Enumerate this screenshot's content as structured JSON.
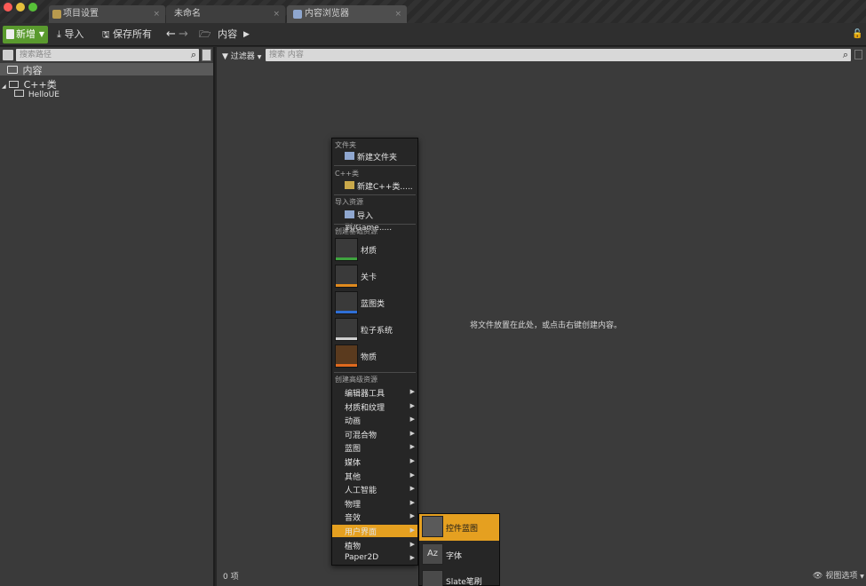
{
  "tabs": [
    {
      "label": "项目设置",
      "close": "×"
    },
    {
      "label": "未命名",
      "close": "×"
    },
    {
      "label": "内容浏览器",
      "close": "×"
    }
  ],
  "toolbar": {
    "new_label": "新增",
    "import_label": "导入",
    "save_all_label": "保存所有",
    "path_label": "内容"
  },
  "left": {
    "search_placeholder": "搜索路径",
    "tree": [
      {
        "label": "内容"
      },
      {
        "label": "C++类"
      },
      {
        "label": "HelloUE"
      }
    ]
  },
  "right": {
    "filter_label": "过滤器",
    "search_placeholder": "搜索 内容",
    "empty_hint": "将文件放置在此处，或点击右键创建内容。",
    "item_count": "0 项",
    "view_options": "视图选项"
  },
  "menu": {
    "sections": {
      "folder": "文件夹",
      "cpp": "C++类",
      "import": "导入资源",
      "basic": "创建基础资源",
      "advanced": "创建高级资源"
    },
    "new_folder": "新建文件夹",
    "new_cpp": "新建C++类.....",
    "import_to": "导入到/Game.....",
    "basic_assets": [
      {
        "label": "材质",
        "color": "#3fa43f"
      },
      {
        "label": "关卡",
        "color": "#e08a1e"
      },
      {
        "label": "蓝图类",
        "color": "#2f6fd6"
      },
      {
        "label": "粒子系统",
        "color": "#cfcfcf"
      },
      {
        "label": "物质",
        "color": "#e06a1e"
      }
    ],
    "advanced": [
      "编辑器工具",
      "材质和纹理",
      "动画",
      "可混合物",
      "蓝图",
      "媒体",
      "其他",
      "人工智能",
      "物理",
      "音效",
      "用户界面",
      "植物",
      "Paper2D"
    ],
    "highlight": "用户界面",
    "highlight_color": "#e5a020"
  },
  "submenu": {
    "items": [
      "控件蓝图",
      "字体",
      "Slate笔刷"
    ]
  }
}
